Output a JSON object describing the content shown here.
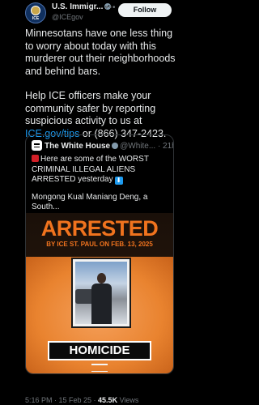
{
  "author": {
    "name": "U.S. Immigr...",
    "handle": "@ICEgov",
    "avatar_text": "ICE"
  },
  "more_icon": "more-horizontal-icon",
  "follow_label": "Follow",
  "tweet": {
    "paragraph1": "Minnesotans have one less thing to worry about today with this murderer out their neighborhoods and behind bars.",
    "paragraph2_prefix": "Help ICE officers make your community safer by reporting suspicious activity to us at ",
    "link": "ICE.gov/tips",
    "paragraph2_suffix": " or (866) 347-2423."
  },
  "quoted": {
    "name": "The White House",
    "handle_time": "@White... · 21h",
    "line1": "Here are some of the WORST CRIMINAL ILLEGAL ALIENS ARRESTED yesterday",
    "line2": "Mongong Kual Maniang Deng, a South...",
    "icons": [
      "siren-icon",
      "down-arrow-icon"
    ],
    "poster": {
      "title": "ARRESTED",
      "subtitle": "BY ICE ST. PAUL ON FEB. 13, 2025",
      "crime": "HOMICIDE"
    }
  },
  "meta": {
    "time": "5:16 PM · 15 Feb 25 · ",
    "views_count": "45.5K",
    "views_label": " Views"
  },
  "colors": {
    "background": "#000000",
    "accent": "#1d9bf0",
    "poster_orange": "#f0731e"
  }
}
